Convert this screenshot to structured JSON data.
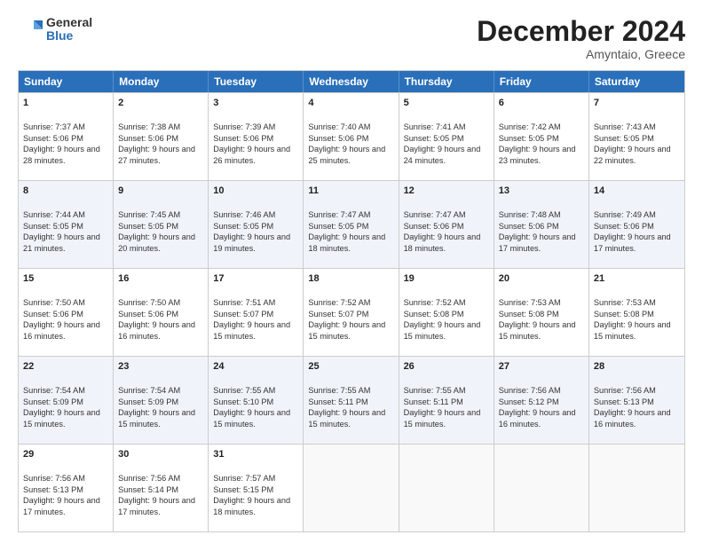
{
  "logo": {
    "general": "General",
    "blue": "Blue"
  },
  "title": "December 2024",
  "subtitle": "Amyntaio, Greece",
  "days": [
    "Sunday",
    "Monday",
    "Tuesday",
    "Wednesday",
    "Thursday",
    "Friday",
    "Saturday"
  ],
  "rows": [
    [
      {
        "day": "1",
        "sunrise": "Sunrise: 7:37 AM",
        "sunset": "Sunset: 5:06 PM",
        "daylight": "Daylight: 9 hours and 28 minutes."
      },
      {
        "day": "2",
        "sunrise": "Sunrise: 7:38 AM",
        "sunset": "Sunset: 5:06 PM",
        "daylight": "Daylight: 9 hours and 27 minutes."
      },
      {
        "day": "3",
        "sunrise": "Sunrise: 7:39 AM",
        "sunset": "Sunset: 5:06 PM",
        "daylight": "Daylight: 9 hours and 26 minutes."
      },
      {
        "day": "4",
        "sunrise": "Sunrise: 7:40 AM",
        "sunset": "Sunset: 5:06 PM",
        "daylight": "Daylight: 9 hours and 25 minutes."
      },
      {
        "day": "5",
        "sunrise": "Sunrise: 7:41 AM",
        "sunset": "Sunset: 5:05 PM",
        "daylight": "Daylight: 9 hours and 24 minutes."
      },
      {
        "day": "6",
        "sunrise": "Sunrise: 7:42 AM",
        "sunset": "Sunset: 5:05 PM",
        "daylight": "Daylight: 9 hours and 23 minutes."
      },
      {
        "day": "7",
        "sunrise": "Sunrise: 7:43 AM",
        "sunset": "Sunset: 5:05 PM",
        "daylight": "Daylight: 9 hours and 22 minutes."
      }
    ],
    [
      {
        "day": "8",
        "sunrise": "Sunrise: 7:44 AM",
        "sunset": "Sunset: 5:05 PM",
        "daylight": "Daylight: 9 hours and 21 minutes."
      },
      {
        "day": "9",
        "sunrise": "Sunrise: 7:45 AM",
        "sunset": "Sunset: 5:05 PM",
        "daylight": "Daylight: 9 hours and 20 minutes."
      },
      {
        "day": "10",
        "sunrise": "Sunrise: 7:46 AM",
        "sunset": "Sunset: 5:05 PM",
        "daylight": "Daylight: 9 hours and 19 minutes."
      },
      {
        "day": "11",
        "sunrise": "Sunrise: 7:47 AM",
        "sunset": "Sunset: 5:05 PM",
        "daylight": "Daylight: 9 hours and 18 minutes."
      },
      {
        "day": "12",
        "sunrise": "Sunrise: 7:47 AM",
        "sunset": "Sunset: 5:06 PM",
        "daylight": "Daylight: 9 hours and 18 minutes."
      },
      {
        "day": "13",
        "sunrise": "Sunrise: 7:48 AM",
        "sunset": "Sunset: 5:06 PM",
        "daylight": "Daylight: 9 hours and 17 minutes."
      },
      {
        "day": "14",
        "sunrise": "Sunrise: 7:49 AM",
        "sunset": "Sunset: 5:06 PM",
        "daylight": "Daylight: 9 hours and 17 minutes."
      }
    ],
    [
      {
        "day": "15",
        "sunrise": "Sunrise: 7:50 AM",
        "sunset": "Sunset: 5:06 PM",
        "daylight": "Daylight: 9 hours and 16 minutes."
      },
      {
        "day": "16",
        "sunrise": "Sunrise: 7:50 AM",
        "sunset": "Sunset: 5:06 PM",
        "daylight": "Daylight: 9 hours and 16 minutes."
      },
      {
        "day": "17",
        "sunrise": "Sunrise: 7:51 AM",
        "sunset": "Sunset: 5:07 PM",
        "daylight": "Daylight: 9 hours and 15 minutes."
      },
      {
        "day": "18",
        "sunrise": "Sunrise: 7:52 AM",
        "sunset": "Sunset: 5:07 PM",
        "daylight": "Daylight: 9 hours and 15 minutes."
      },
      {
        "day": "19",
        "sunrise": "Sunrise: 7:52 AM",
        "sunset": "Sunset: 5:08 PM",
        "daylight": "Daylight: 9 hours and 15 minutes."
      },
      {
        "day": "20",
        "sunrise": "Sunrise: 7:53 AM",
        "sunset": "Sunset: 5:08 PM",
        "daylight": "Daylight: 9 hours and 15 minutes."
      },
      {
        "day": "21",
        "sunrise": "Sunrise: 7:53 AM",
        "sunset": "Sunset: 5:08 PM",
        "daylight": "Daylight: 9 hours and 15 minutes."
      }
    ],
    [
      {
        "day": "22",
        "sunrise": "Sunrise: 7:54 AM",
        "sunset": "Sunset: 5:09 PM",
        "daylight": "Daylight: 9 hours and 15 minutes."
      },
      {
        "day": "23",
        "sunrise": "Sunrise: 7:54 AM",
        "sunset": "Sunset: 5:09 PM",
        "daylight": "Daylight: 9 hours and 15 minutes."
      },
      {
        "day": "24",
        "sunrise": "Sunrise: 7:55 AM",
        "sunset": "Sunset: 5:10 PM",
        "daylight": "Daylight: 9 hours and 15 minutes."
      },
      {
        "day": "25",
        "sunrise": "Sunrise: 7:55 AM",
        "sunset": "Sunset: 5:11 PM",
        "daylight": "Daylight: 9 hours and 15 minutes."
      },
      {
        "day": "26",
        "sunrise": "Sunrise: 7:55 AM",
        "sunset": "Sunset: 5:11 PM",
        "daylight": "Daylight: 9 hours and 15 minutes."
      },
      {
        "day": "27",
        "sunrise": "Sunrise: 7:56 AM",
        "sunset": "Sunset: 5:12 PM",
        "daylight": "Daylight: 9 hours and 16 minutes."
      },
      {
        "day": "28",
        "sunrise": "Sunrise: 7:56 AM",
        "sunset": "Sunset: 5:13 PM",
        "daylight": "Daylight: 9 hours and 16 minutes."
      }
    ],
    [
      {
        "day": "29",
        "sunrise": "Sunrise: 7:56 AM",
        "sunset": "Sunset: 5:13 PM",
        "daylight": "Daylight: 9 hours and 17 minutes."
      },
      {
        "day": "30",
        "sunrise": "Sunrise: 7:56 AM",
        "sunset": "Sunset: 5:14 PM",
        "daylight": "Daylight: 9 hours and 17 minutes."
      },
      {
        "day": "31",
        "sunrise": "Sunrise: 7:57 AM",
        "sunset": "Sunset: 5:15 PM",
        "daylight": "Daylight: 9 hours and 18 minutes."
      },
      null,
      null,
      null,
      null
    ]
  ]
}
